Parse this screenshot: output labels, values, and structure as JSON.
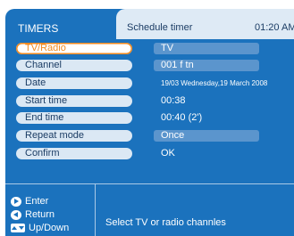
{
  "screen": {
    "title": "TIMERS"
  },
  "header": {
    "title": "Schedule timer",
    "clock": "01:20 AM"
  },
  "rows": [
    {
      "label": "TV/Radio",
      "value": "TV",
      "selected": true
    },
    {
      "label": "Channel",
      "value": "001 f tn"
    },
    {
      "label": "Date",
      "value": "19/03 Wednesday,19 March 2008"
    },
    {
      "label": "Start time",
      "value": "00:38"
    },
    {
      "label": "End time",
      "value": "00:40  (2')"
    },
    {
      "label": "Repeat mode",
      "value": "Once"
    },
    {
      "label": "Confirm",
      "value": "OK"
    }
  ],
  "help": {
    "enter": "Enter",
    "return": "Return",
    "updown": "Up/Down"
  },
  "hint": "Select  TV or radio channles",
  "colors": {
    "background": "#1b72bd",
    "selected_outline": "#f08a20",
    "pill": "#dbe8f4",
    "value_box": "#5b95cd"
  }
}
